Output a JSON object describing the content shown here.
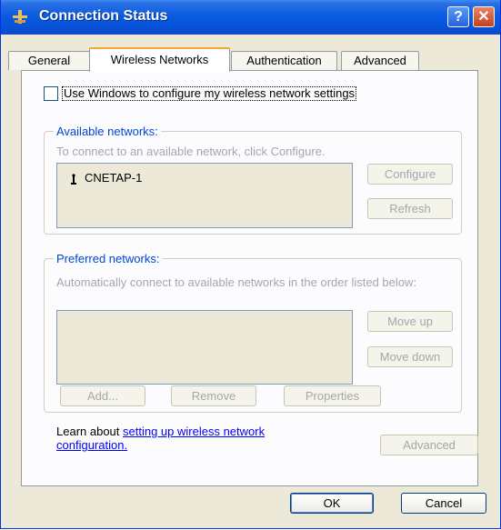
{
  "window": {
    "title": "Connection Status"
  },
  "titlebar": {
    "help_label": "?",
    "close_label": "✕"
  },
  "tabs": [
    {
      "label": "General",
      "active": false
    },
    {
      "label": "Wireless Networks",
      "active": true
    },
    {
      "label": "Authentication",
      "active": false
    },
    {
      "label": "Advanced",
      "active": false
    }
  ],
  "checkbox": {
    "label": "Use Windows to configure my wireless network settings",
    "checked": false
  },
  "available": {
    "title": "Available networks:",
    "description": "To connect to an available network, click Configure.",
    "networks": [
      {
        "name": "CNETAP-1",
        "icon": "antenna-icon"
      }
    ],
    "configure_label": "Configure",
    "refresh_label": "Refresh"
  },
  "preferred": {
    "title": "Preferred networks:",
    "description": "Automatically connect to available networks in the order listed below:",
    "move_up_label": "Move up",
    "move_down_label": "Move down",
    "add_label": "Add...",
    "remove_label": "Remove",
    "properties_label": "Properties"
  },
  "learn": {
    "prefix": "Learn about ",
    "link": "setting up wireless network configuration."
  },
  "advanced_label": "Advanced",
  "footer": {
    "ok_label": "OK",
    "cancel_label": "Cancel"
  }
}
